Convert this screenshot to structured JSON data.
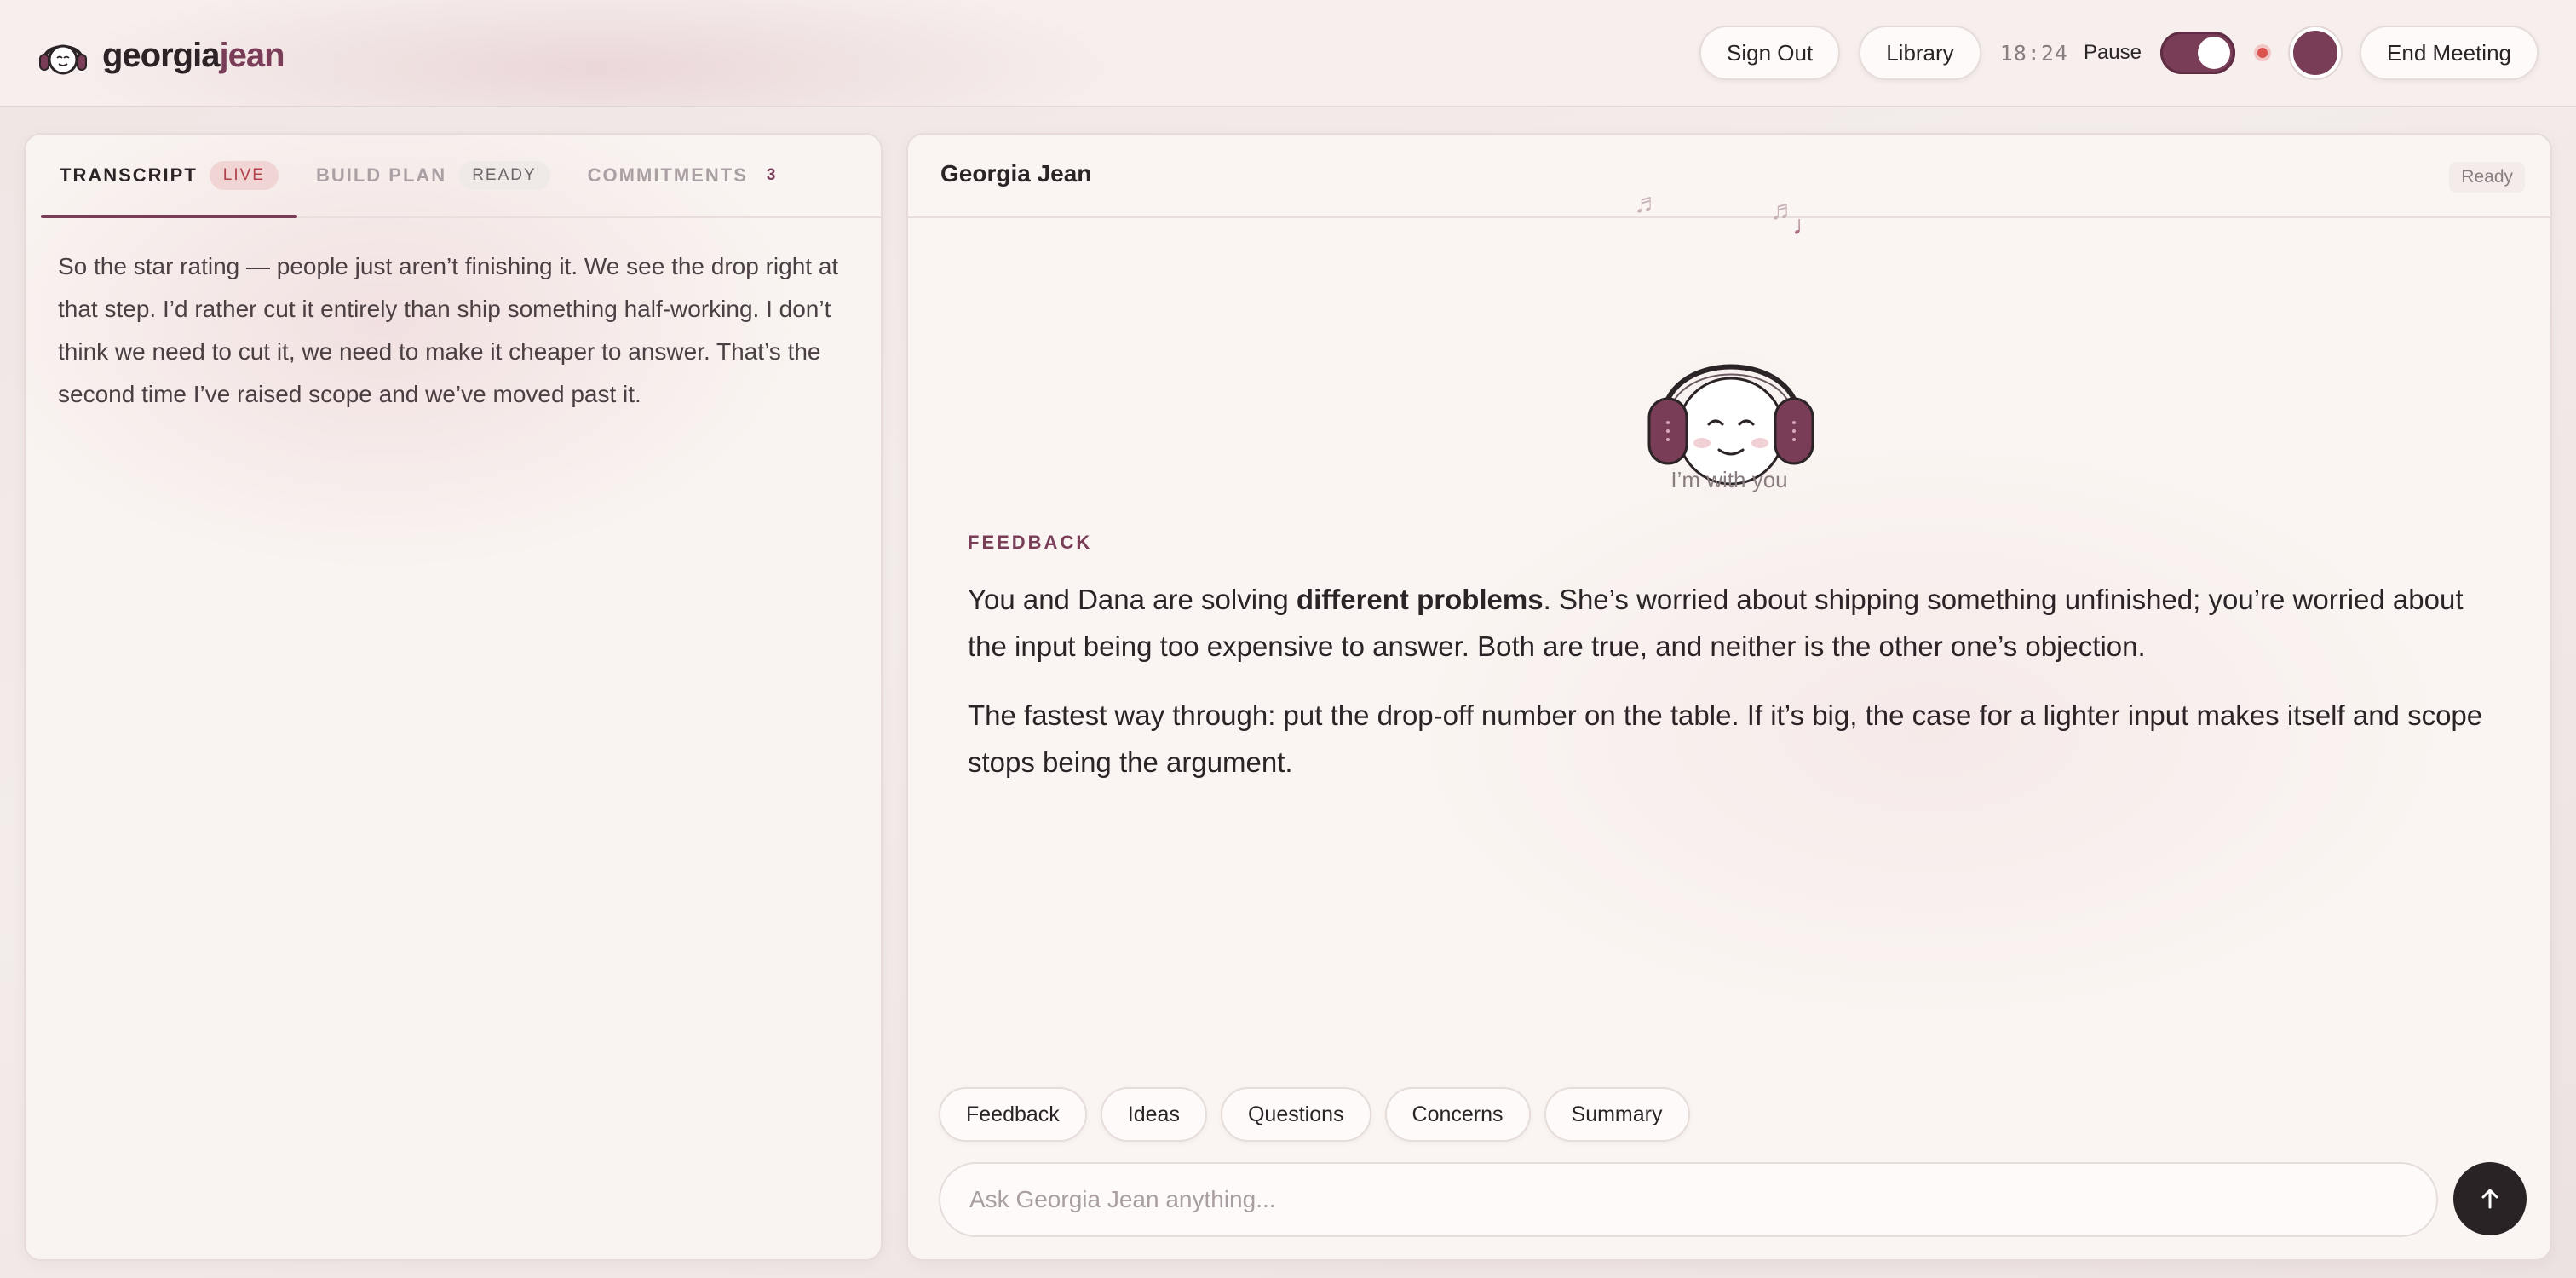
{
  "brand": {
    "name_main": "georgia",
    "name_accent": "jean"
  },
  "header": {
    "sign_out": "Sign Out",
    "library": "Library",
    "timer": "18:24",
    "pause_label": "Pause",
    "end_meeting": "End Meeting",
    "pause_toggle_on": true
  },
  "left": {
    "tabs": [
      {
        "label": "TRANSCRIPT",
        "badge": "LIVE",
        "active": true
      },
      {
        "label": "BUILD PLAN",
        "badge": "READY",
        "active": false
      },
      {
        "label": "COMMITMENTS",
        "badge": "3",
        "active": false
      }
    ],
    "transcript": "So the star rating — people just aren’t finishing it. We see the drop right at that step. I’d rather cut it entirely than ship something half-working. I don’t think we need to cut it, we need to make it cheaper to answer. That’s the second time I’ve raised scope and we’ve moved past it."
  },
  "right": {
    "title": "Georgia Jean",
    "status": "Ready",
    "caption": "I’m with you",
    "section_label": "FEEDBACK",
    "p1_before": "You and Dana are solving ",
    "p1_bold": "different problems",
    "p1_after": ". She’s worried about shipping something unfinished; you’re worried about the input being too expensive to answer. Both are true, and neither is the other one’s objection.",
    "p2": "The fastest way through: put the drop-off number on the table. If it’s big, the case for a lighter input makes itself and scope stops being the argument.",
    "chips": [
      "Feedback",
      "Ideas",
      "Questions",
      "Concerns",
      "Summary"
    ],
    "input_placeholder": "Ask Georgia Jean anything..."
  },
  "colors": {
    "accent": "#7a3d58",
    "live_badge": "#b0424a",
    "send_button": "#2a2325"
  },
  "icons": {
    "logo": "headphones-face-icon",
    "send": "arrow-up-icon",
    "mascot": "headphones-mascot-icon",
    "notes": "music-note-icon"
  }
}
